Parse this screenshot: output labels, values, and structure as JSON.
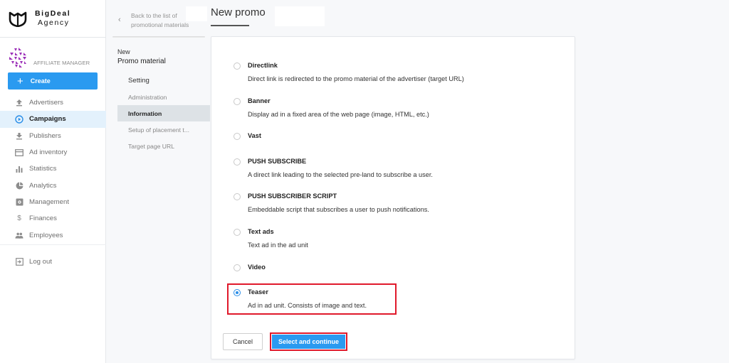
{
  "brand": {
    "name": "BigDeal",
    "subtitle": "Agency",
    "logo_icon": "bigdeal-shield-logo"
  },
  "role": {
    "label": "AFFILIATE MANAGER",
    "avatar_icon": "purple-geometric-avatar"
  },
  "create_button": {
    "label": "Create",
    "icon": "plus-icon",
    "color": "#2a9af0"
  },
  "sidebar": {
    "items": [
      {
        "label": "Advertisers",
        "icon": "upload-arrow-icon",
        "active": false
      },
      {
        "label": "Campaigns",
        "icon": "play-circle-icon",
        "active": true
      },
      {
        "label": "Publishers",
        "icon": "download-arrow-icon",
        "active": false
      },
      {
        "label": "Ad inventory",
        "icon": "window-icon",
        "active": false
      },
      {
        "label": "Statistics",
        "icon": "bar-chart-icon",
        "active": false
      },
      {
        "label": "Analytics",
        "icon": "pie-chart-icon",
        "active": false
      },
      {
        "label": "Management",
        "icon": "settings-box-icon",
        "active": false
      },
      {
        "label": "Finances",
        "icon": "dollar-icon",
        "active": false
      },
      {
        "label": "Employees",
        "icon": "people-icon",
        "active": false
      }
    ],
    "logout": {
      "label": "Log out",
      "icon": "logout-icon"
    }
  },
  "subnav": {
    "back_line1": "Back to the list of",
    "back_line2": "promotional materials",
    "new_label": "New",
    "title": "Promo material",
    "items": [
      {
        "label": "Setting",
        "type": "heading"
      },
      {
        "label": "Administration",
        "type": "link",
        "active": false
      },
      {
        "label": "Information",
        "type": "link",
        "active": true
      },
      {
        "label": "Setup of placement t...",
        "type": "link",
        "active": false
      },
      {
        "label": "Target page URL",
        "type": "link",
        "active": false
      }
    ]
  },
  "header": {
    "title": "New promo"
  },
  "options": [
    {
      "title": "Directlink",
      "description": "Direct link is redirected to the promo material of the advertiser (target URL)",
      "selected": false
    },
    {
      "title": "Banner",
      "description": "Display ad in a fixed area of the web page (image, HTML, etc.)",
      "selected": false
    },
    {
      "title": "Vast",
      "description": "",
      "selected": false
    },
    {
      "title": "PUSH SUBSCRIBE",
      "description": "A direct link leading to the selected pre-land to subscribe a user.",
      "selected": false
    },
    {
      "title": "PUSH SUBSCRIBER SCRIPT",
      "description": "Embeddable script that subscribes a user to push notifications.",
      "selected": false
    },
    {
      "title": "Text ads",
      "description": "Text ad in the ad unit",
      "selected": false
    },
    {
      "title": "Video",
      "description": "",
      "selected": false
    },
    {
      "title": "Teaser",
      "description": "Ad in ad unit. Consists of image and text.",
      "selected": true
    }
  ],
  "actions": {
    "cancel_label": "Cancel",
    "continue_label": "Select and continue",
    "highlight_color": "#e0192b"
  }
}
